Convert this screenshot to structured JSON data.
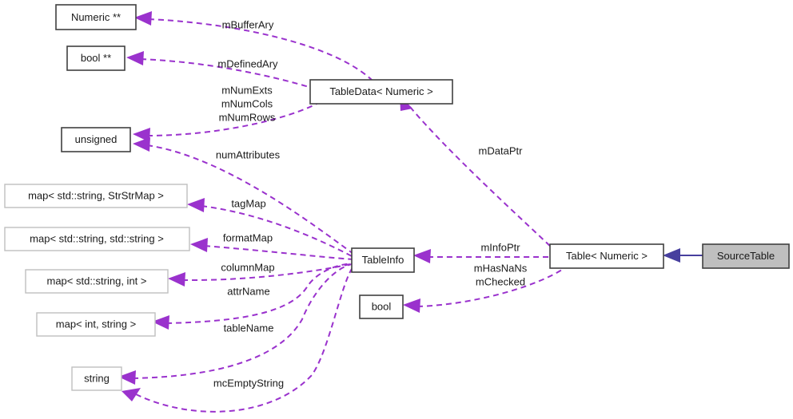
{
  "diagram": {
    "title": "SourceTable collaboration diagram",
    "background_color": "#ffffff",
    "usage_edge_color": "#9a32cd",
    "inheritance_edge_color": "#473f9e",
    "highlight_fill": "#bfbfbf",
    "nodes": [
      {
        "id": "numeric_pp",
        "label": "Numeric **"
      },
      {
        "id": "bool_pp",
        "label": "bool **"
      },
      {
        "id": "tabledata",
        "label": "TableData< Numeric >"
      },
      {
        "id": "unsigned",
        "label": "unsigned"
      },
      {
        "id": "map_str_strstrmap",
        "label": "map< std::string, StrStrMap >"
      },
      {
        "id": "map_str_str",
        "label": "map< std::string, std::string >"
      },
      {
        "id": "map_str_int",
        "label": "map< std::string, int >"
      },
      {
        "id": "map_int_string",
        "label": "map< int, string >"
      },
      {
        "id": "string",
        "label": "string"
      },
      {
        "id": "tableinfo",
        "label": "TableInfo"
      },
      {
        "id": "bool",
        "label": "bool"
      },
      {
        "id": "table_numeric",
        "label": "Table< Numeric >"
      },
      {
        "id": "sourcetable",
        "label": "SourceTable"
      }
    ],
    "edge_labels": [
      {
        "id": "mBufferAry",
        "text": "mBufferAry"
      },
      {
        "id": "mDefinedAry",
        "text": "mDefinedAry"
      },
      {
        "id": "mNumExts",
        "text": "mNumExts"
      },
      {
        "id": "mNumCols",
        "text": "mNumCols"
      },
      {
        "id": "mNumRows",
        "text": "mNumRows"
      },
      {
        "id": "numAttributes",
        "text": "numAttributes"
      },
      {
        "id": "tagMap",
        "text": "tagMap"
      },
      {
        "id": "formatMap",
        "text": "formatMap"
      },
      {
        "id": "columnMap",
        "text": "columnMap"
      },
      {
        "id": "attrName",
        "text": "attrName"
      },
      {
        "id": "tableName",
        "text": "tableName"
      },
      {
        "id": "mcEmptyString",
        "text": "mcEmptyString"
      },
      {
        "id": "mDataPtr",
        "text": "mDataPtr"
      },
      {
        "id": "mInfoPtr",
        "text": "mInfoPtr"
      },
      {
        "id": "mHasNaNs",
        "text": "mHasNaNs"
      },
      {
        "id": "mChecked",
        "text": "mChecked"
      }
    ]
  }
}
